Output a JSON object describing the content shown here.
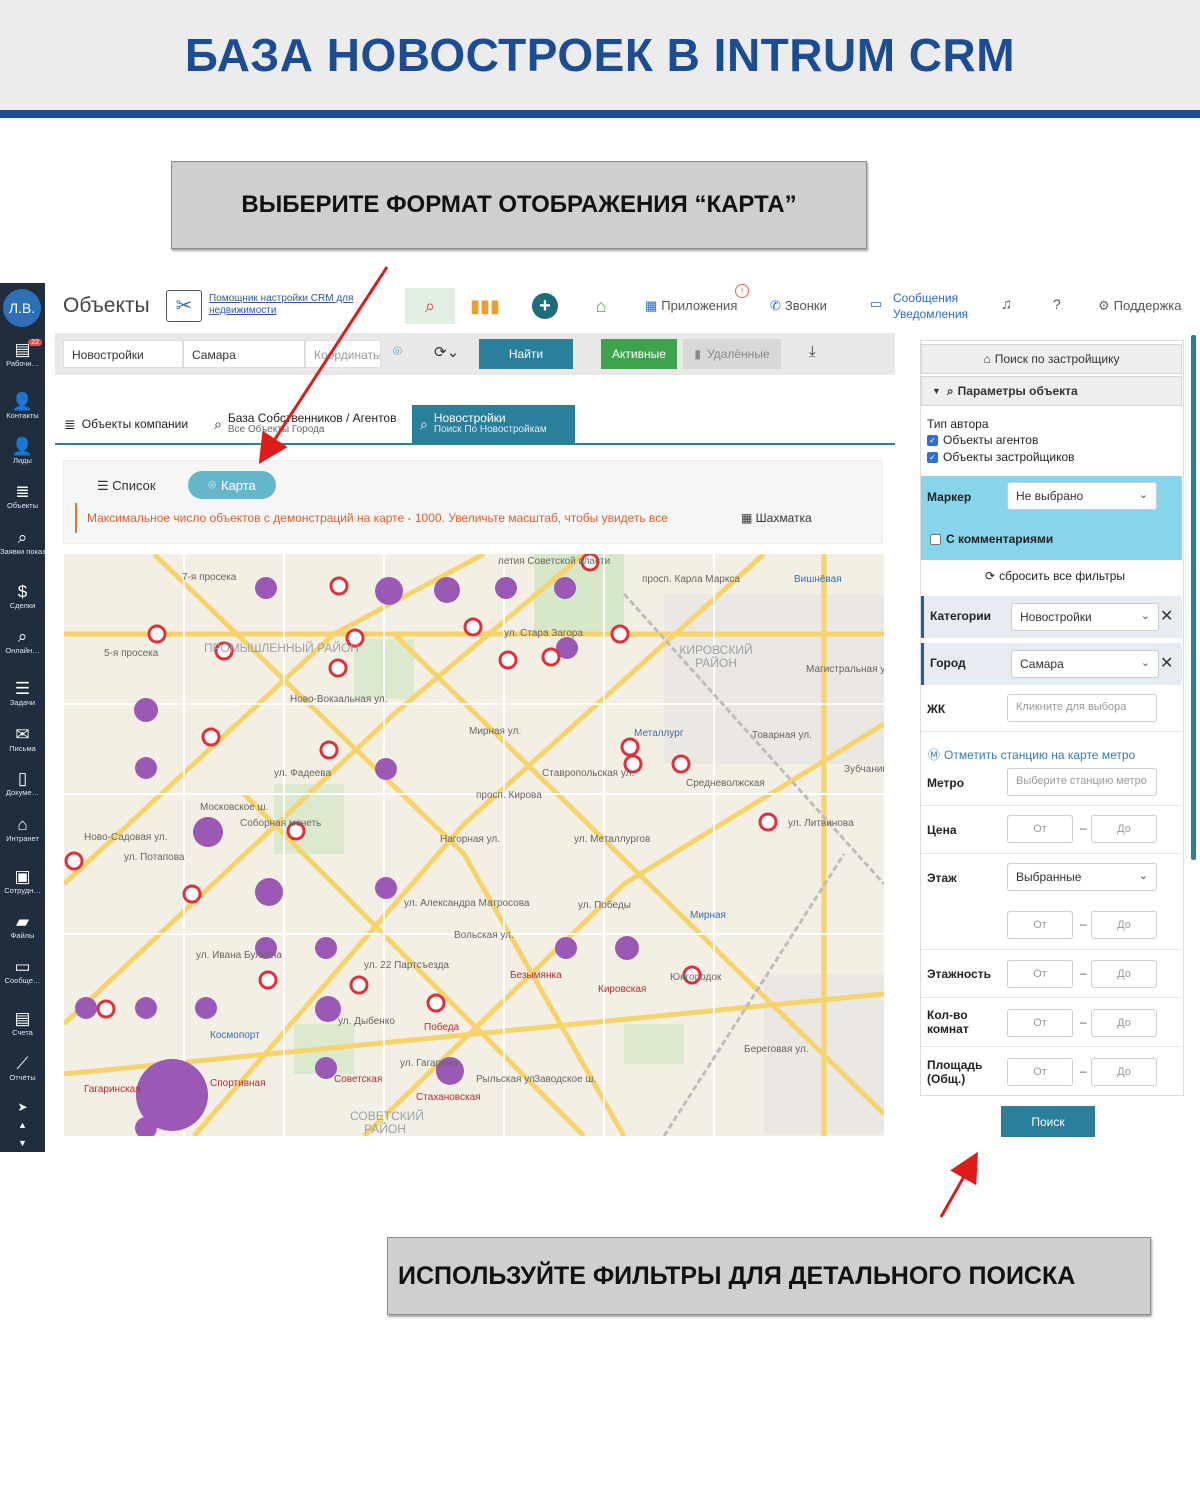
{
  "banner": {
    "title": "БАЗА НОВОСТРОЕК В INTRUM CRM"
  },
  "callouts": {
    "top": "ВЫБЕРИТЕ ФОРМАТ ОТОБРАЖЕНИЯ “КАРТА”",
    "bottom": "ИСПОЛЬЗУЙТЕ ФИЛЬТРЫ ДЛЯ ДЕТАЛЬНОГО ПОИСКА"
  },
  "sidebar": {
    "avatar": "Л.В.",
    "badge": "22",
    "items": [
      {
        "label": "Рабочи…",
        "icon": "dashboard-icon"
      },
      {
        "label": "Контакты",
        "icon": "contacts-icon"
      },
      {
        "label": "Лиды",
        "icon": "leads-icon"
      },
      {
        "label": "Объекты",
        "icon": "objects-icon"
      },
      {
        "label": "Заявки показы",
        "icon": "requests-icon"
      },
      {
        "label": "Сделки",
        "icon": "deals-icon"
      },
      {
        "label": "Онлайн…",
        "icon": "online-icon"
      },
      {
        "label": "Задачи",
        "icon": "tasks-icon"
      },
      {
        "label": "Письма",
        "icon": "mail-icon"
      },
      {
        "label": "Докуме…",
        "icon": "documents-icon"
      },
      {
        "label": "Интранет",
        "icon": "intranet-icon"
      },
      {
        "label": "Сотрудн…",
        "icon": "staff-icon"
      },
      {
        "label": "Файлы",
        "icon": "files-icon"
      },
      {
        "label": "Сообще…",
        "icon": "messages-icon"
      },
      {
        "label": "Счета",
        "icon": "invoices-icon"
      },
      {
        "label": "Отчёты",
        "icon": "reports-icon"
      }
    ]
  },
  "header": {
    "title": "Объекты",
    "helper_link": "Помощник настройки CRM для недвижимости",
    "apps": "Приложения",
    "calls": "Звонки",
    "messages": "Сообщения",
    "notifications": "Уведомления",
    "support": "Поддержка",
    "alert": "!"
  },
  "toolbar": {
    "category": "Новостройки",
    "city": "Самара",
    "coords_placeholder": "Координаты",
    "find": "Найти",
    "active": "Активные",
    "deleted": "Удалённые"
  },
  "tabs": [
    {
      "label": "Объекты компании",
      "sub": ""
    },
    {
      "label": "База Собственников / Агентов",
      "sub": "Все Объекты Города"
    },
    {
      "label": "Новостройки",
      "sub": "Поиск По Новостройкам"
    }
  ],
  "view": {
    "list": "Список",
    "map": "Карта",
    "warning": "Максимальное число объектов с демонстраций на карте - 1000. Увеличьте масштаб, чтобы увидеть все",
    "chess": "Шахматка"
  },
  "map": {
    "districts": [
      "ПРОМЫШЛЕННЫЙ РАЙОН",
      "КИРОВСКИЙ РАЙОН",
      "СОВЕТСКИЙ РАЙОН"
    ],
    "streets": [
      "7-я просека",
      "5-я просека",
      "летия Советской власти",
      "просп. Карла Маркса",
      "ул. Стара Загора",
      "Ново-Вокзальная ул.",
      "ул. Фадеева",
      "Мирная ул.",
      "просп. Кирова",
      "Ставропольская ул.",
      "ул. Металлургов",
      "Ново-Садовая ул.",
      "ул. Потапова",
      "Московское ш.",
      "Нагорная ул.",
      "ул. Александра Матросова",
      "ул. Победы",
      "ул. 22 Партсъезда",
      "ул. Дыбенко",
      "ул. Гагарина",
      "Рыльская ул.",
      "Заводское ш.",
      "Береговая ул.",
      "Товарная ул.",
      "Магистральная ул.",
      "ул. Литвинова",
      "Зубчаниновка",
      "Вольская ул.",
      "ул. Ивана Булкина"
    ],
    "places": [
      "Вишнёвая",
      "Металлург",
      "Средневолжская",
      "Соборная мечеть",
      "Мирная",
      "Безымянка",
      "Кировская",
      "Юнгородок",
      "Космопорт",
      "Победа",
      "Гагаринская",
      "Спортивная",
      "Советская",
      "Стахановская"
    ]
  },
  "filters": {
    "by_developer": "Поиск по застройщику",
    "params": "Параметры объекта",
    "author_type": "Тип автора",
    "agents": "Объекты агентов",
    "developers": "Объекты застройщиков",
    "marker_label": "Маркер",
    "marker_value": "Не выбрано",
    "with_comments": "С комментариями",
    "reset": "сбросить все фильтры",
    "category_label": "Категории",
    "category_value": "Новостройки",
    "city_label": "Город",
    "city_value": "Самара",
    "complex_label": "ЖК",
    "complex_placeholder": "Кликните для выбора",
    "metro_link": "Отметить станцию на карте метро",
    "metro_label": "Метро",
    "metro_placeholder": "Выберите станцию метро",
    "price_label": "Цена",
    "floor_label": "Этаж",
    "floor_value": "Выбранные",
    "floors_label": "Этажность",
    "rooms_label": "Кол-во комнат",
    "area_label": "Площадь (Общ.)",
    "from": "От",
    "to": "До",
    "search": "Поиск"
  },
  "colors": {
    "brand": "#1c4d94",
    "accent": "#2a7f9b",
    "cluster": "#9b59b6",
    "pin": "#e0303c"
  }
}
